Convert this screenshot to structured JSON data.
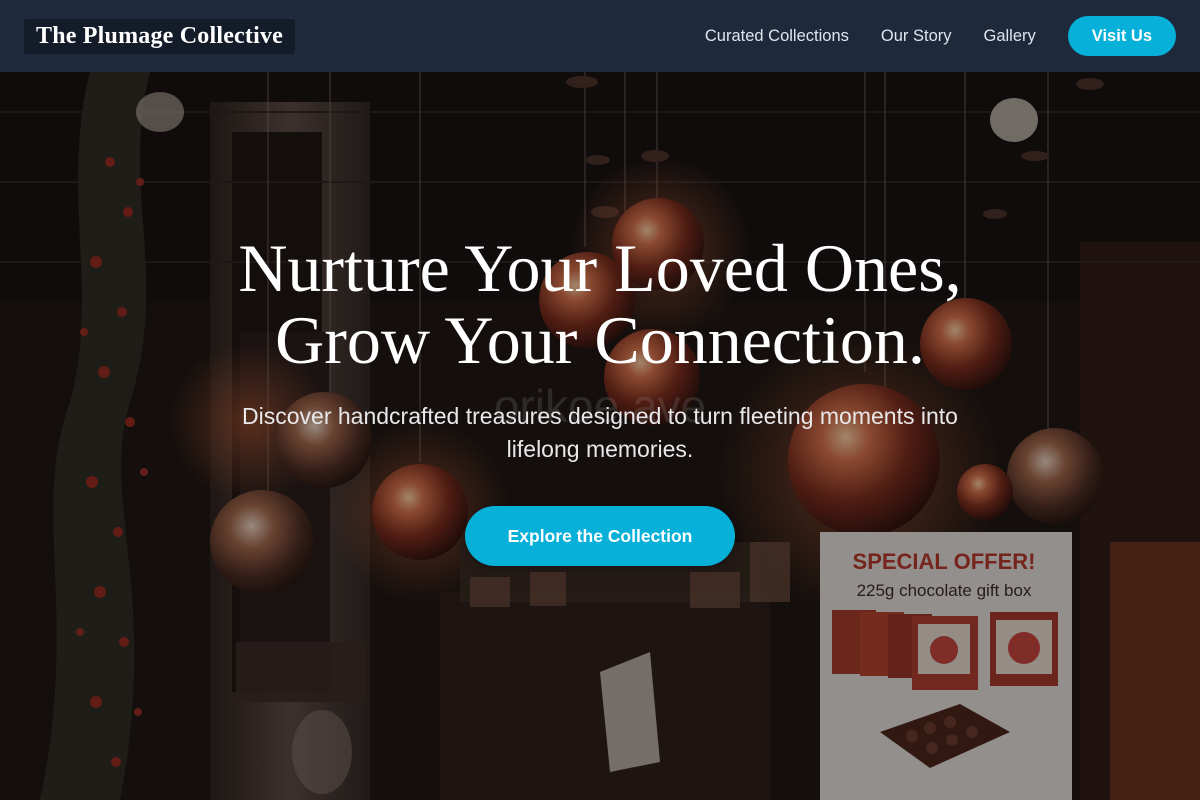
{
  "header": {
    "brand": "The Plumage Collective",
    "nav": [
      "Curated Collections",
      "Our Story",
      "Gallery"
    ],
    "visit_label": "Visit Us"
  },
  "hero": {
    "headline_line1": "Nurture Your Loved Ones,",
    "headline_line2": "Grow Your Connection.",
    "subtitle_line1": "Discover handcrafted treasures designed to turn fleeting moments into",
    "subtitle_line2": "lifelong memories.",
    "cta_label": "Explore the Collection"
  },
  "background_image": {
    "sign_title": "SPECIAL OFFER!",
    "sign_subtitle": "225g chocolate gift box",
    "window_lettering": "orikoe ave"
  },
  "colors": {
    "header_bg": "#1e293b",
    "accent": "#06b0d8",
    "text": "#ffffff"
  }
}
